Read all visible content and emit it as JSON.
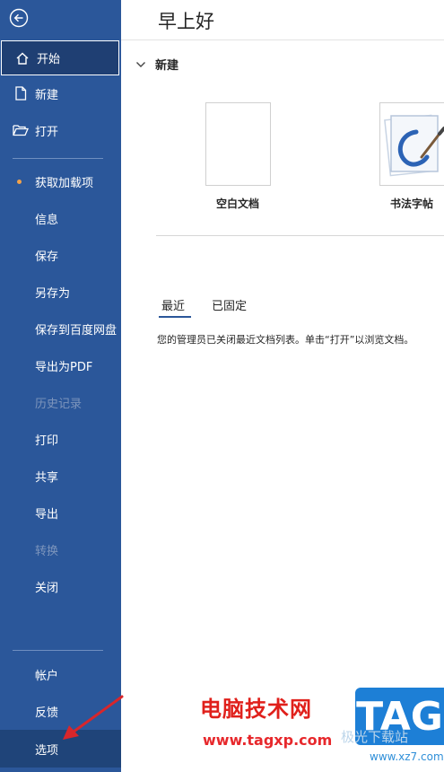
{
  "sidebar": {
    "items": [
      {
        "label": "开始"
      },
      {
        "label": "新建"
      },
      {
        "label": "打开"
      },
      {
        "label": "获取加载项"
      },
      {
        "label": "信息"
      },
      {
        "label": "保存"
      },
      {
        "label": "另存为"
      },
      {
        "label": "保存到百度网盘"
      },
      {
        "label": "导出为PDF"
      },
      {
        "label": "历史记录"
      },
      {
        "label": "打印"
      },
      {
        "label": "共享"
      },
      {
        "label": "导出"
      },
      {
        "label": "转换"
      },
      {
        "label": "关闭"
      },
      {
        "label": "帐户"
      },
      {
        "label": "反馈"
      },
      {
        "label": "选项"
      }
    ]
  },
  "main": {
    "greeting": "早上好",
    "new_section": "新建",
    "templates": [
      {
        "label": "空白文档"
      },
      {
        "label": "书法字帖"
      }
    ],
    "tabs": [
      {
        "label": "最近"
      },
      {
        "label": "已固定"
      }
    ],
    "notice": "您的管理员已关闭最近文档列表。单击“打开”以浏览文档。"
  },
  "watermark": {
    "site_name": "电脑技术网",
    "url": "www.tagxp.com",
    "badge": "TAG",
    "cn_text": "极光下载站",
    "xz_url": "www.xz7.com"
  },
  "colors": {
    "sidebar": "#2b579a",
    "accent_dot": "#f2a24a"
  }
}
